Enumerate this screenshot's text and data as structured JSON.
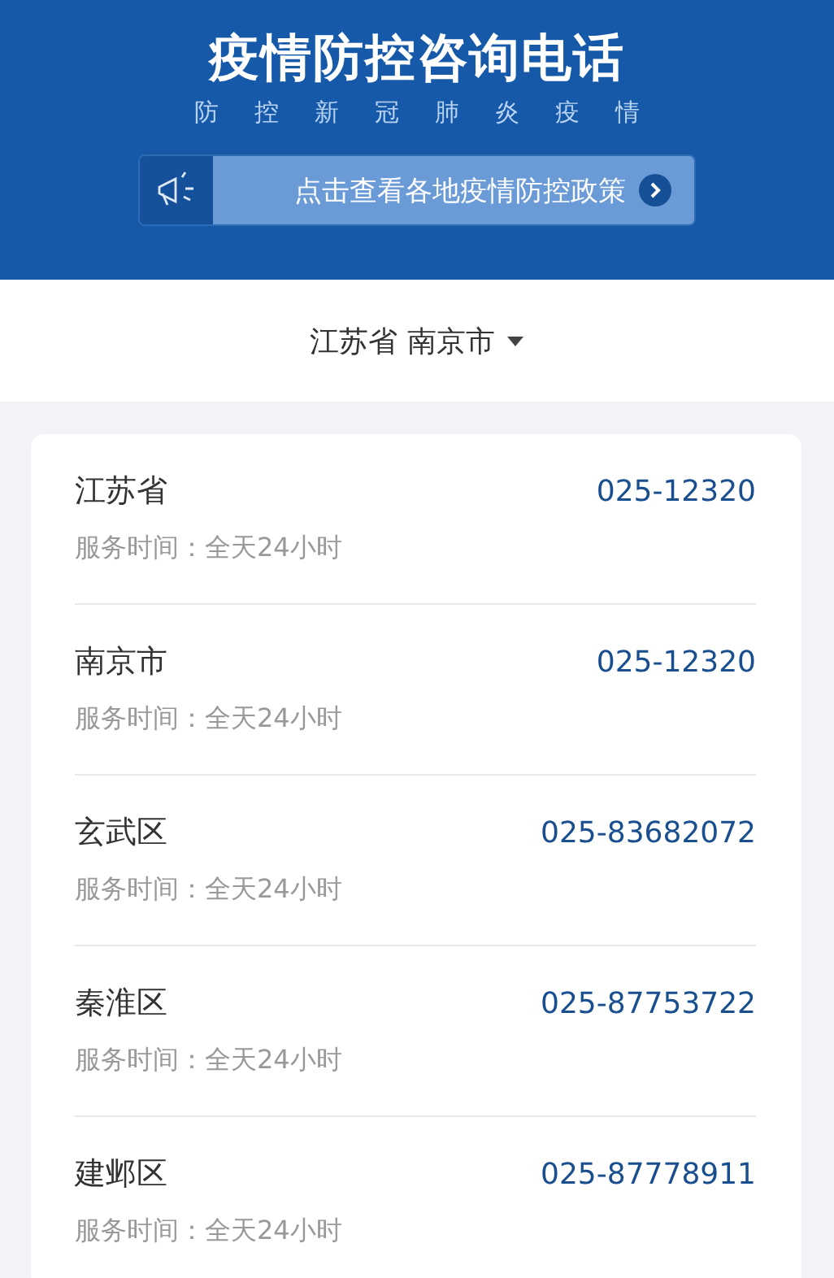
{
  "header": {
    "title": "疫情防控咨询电话",
    "subtitle": "防控新冠肺炎疫情",
    "banner": {
      "text": "点击查看各地疫情防控政策"
    }
  },
  "location": {
    "label": "江苏省 南京市"
  },
  "contacts": [
    {
      "name": "江苏省",
      "phone": "025-12320",
      "hours": "服务时间：全天24小时"
    },
    {
      "name": "南京市",
      "phone": "025-12320",
      "hours": "服务时间：全天24小时"
    },
    {
      "name": "玄武区",
      "phone": "025-83682072",
      "hours": "服务时间：全天24小时"
    },
    {
      "name": "秦淮区",
      "phone": "025-87753722",
      "hours": "服务时间：全天24小时"
    },
    {
      "name": "建邺区",
      "phone": "025-87778911",
      "hours": "服务时间：全天24小时"
    }
  ]
}
